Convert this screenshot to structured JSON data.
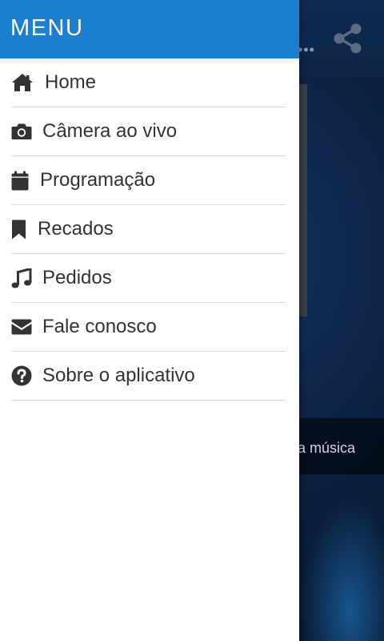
{
  "drawer": {
    "title": "MENU",
    "items": [
      {
        "label": "Home",
        "icon": "home-icon"
      },
      {
        "label": "Câmera ao vivo",
        "icon": "camera-icon"
      },
      {
        "label": "Programação",
        "icon": "calendar-icon"
      },
      {
        "label": "Recados",
        "icon": "bookmark-icon"
      },
      {
        "label": "Pedidos",
        "icon": "music-note-icon"
      },
      {
        "label": "Fale conosco",
        "icon": "envelope-icon"
      },
      {
        "label": "Sobre o aplicativo",
        "icon": "question-circle-icon"
      }
    ]
  },
  "background": {
    "now_playing_text": "a música"
  },
  "colors": {
    "header": "#1a7fd1",
    "drawer_bg": "#ffffff",
    "text": "#333333",
    "divider": "#dcdcdc"
  }
}
